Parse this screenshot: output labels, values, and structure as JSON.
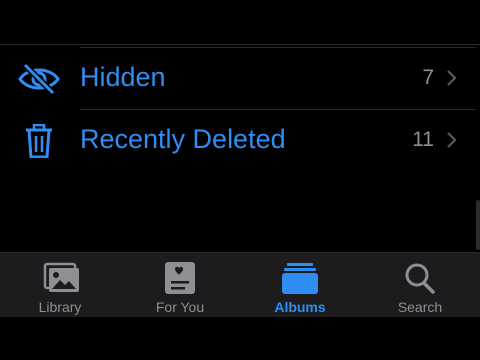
{
  "rows": [
    {
      "label": "Hidden",
      "count": "7",
      "icon": "eye-slash-icon"
    },
    {
      "label": "Recently Deleted",
      "count": "11",
      "icon": "trash-icon"
    }
  ],
  "tabbar": {
    "tabs": [
      {
        "label": "Library",
        "icon": "photo-library-icon",
        "active": false
      },
      {
        "label": "For You",
        "icon": "for-you-icon",
        "active": false
      },
      {
        "label": "Albums",
        "icon": "albums-icon",
        "active": true
      },
      {
        "label": "Search",
        "icon": "search-icon",
        "active": false
      }
    ]
  },
  "colors": {
    "accent": "#2f8ef4",
    "inactive": "#8e8e93",
    "background": "#000000",
    "tabbar": "#1c1c1e"
  }
}
